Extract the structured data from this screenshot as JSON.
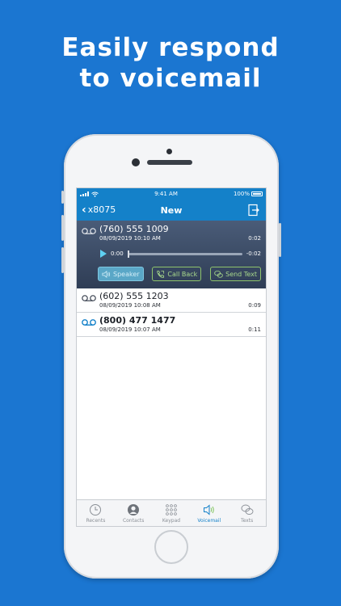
{
  "headline": {
    "line1": "Easily respond",
    "line2": "to voicemail"
  },
  "status_bar": {
    "time": "9:41 AM",
    "battery": "100%"
  },
  "nav": {
    "back_label": "x8075",
    "title": "New",
    "logout_icon": "logout-icon"
  },
  "expanded_voicemail": {
    "number": "(760) 555 1009",
    "datetime": "08/09/2019 10:10 AM",
    "duration": "0:02",
    "position": "0:00",
    "remaining": "-0:02",
    "progress": 0,
    "actions": {
      "speaker": "Speaker",
      "call_back": "Call Back",
      "send_text": "Send Text"
    }
  },
  "voicemails": [
    {
      "number": "(602) 555 1203",
      "datetime": "08/09/2019 10:08 AM",
      "duration": "0:09",
      "new": false
    },
    {
      "number": "(800) 477 1477",
      "datetime": "08/09/2019 10:07 AM",
      "duration": "0:11",
      "new": true
    }
  ],
  "tabs": [
    {
      "label": "Recents",
      "icon": "clock-icon"
    },
    {
      "label": "Contacts",
      "icon": "contact-icon"
    },
    {
      "label": "Keypad",
      "icon": "keypad-icon"
    },
    {
      "label": "Voicemail",
      "icon": "voicemail-speaker-icon",
      "active": true
    },
    {
      "label": "Texts",
      "icon": "chat-icon"
    }
  ],
  "colors": {
    "background": "#1b76d1",
    "accent": "#1481c9",
    "action_green": "#8fc46c"
  }
}
